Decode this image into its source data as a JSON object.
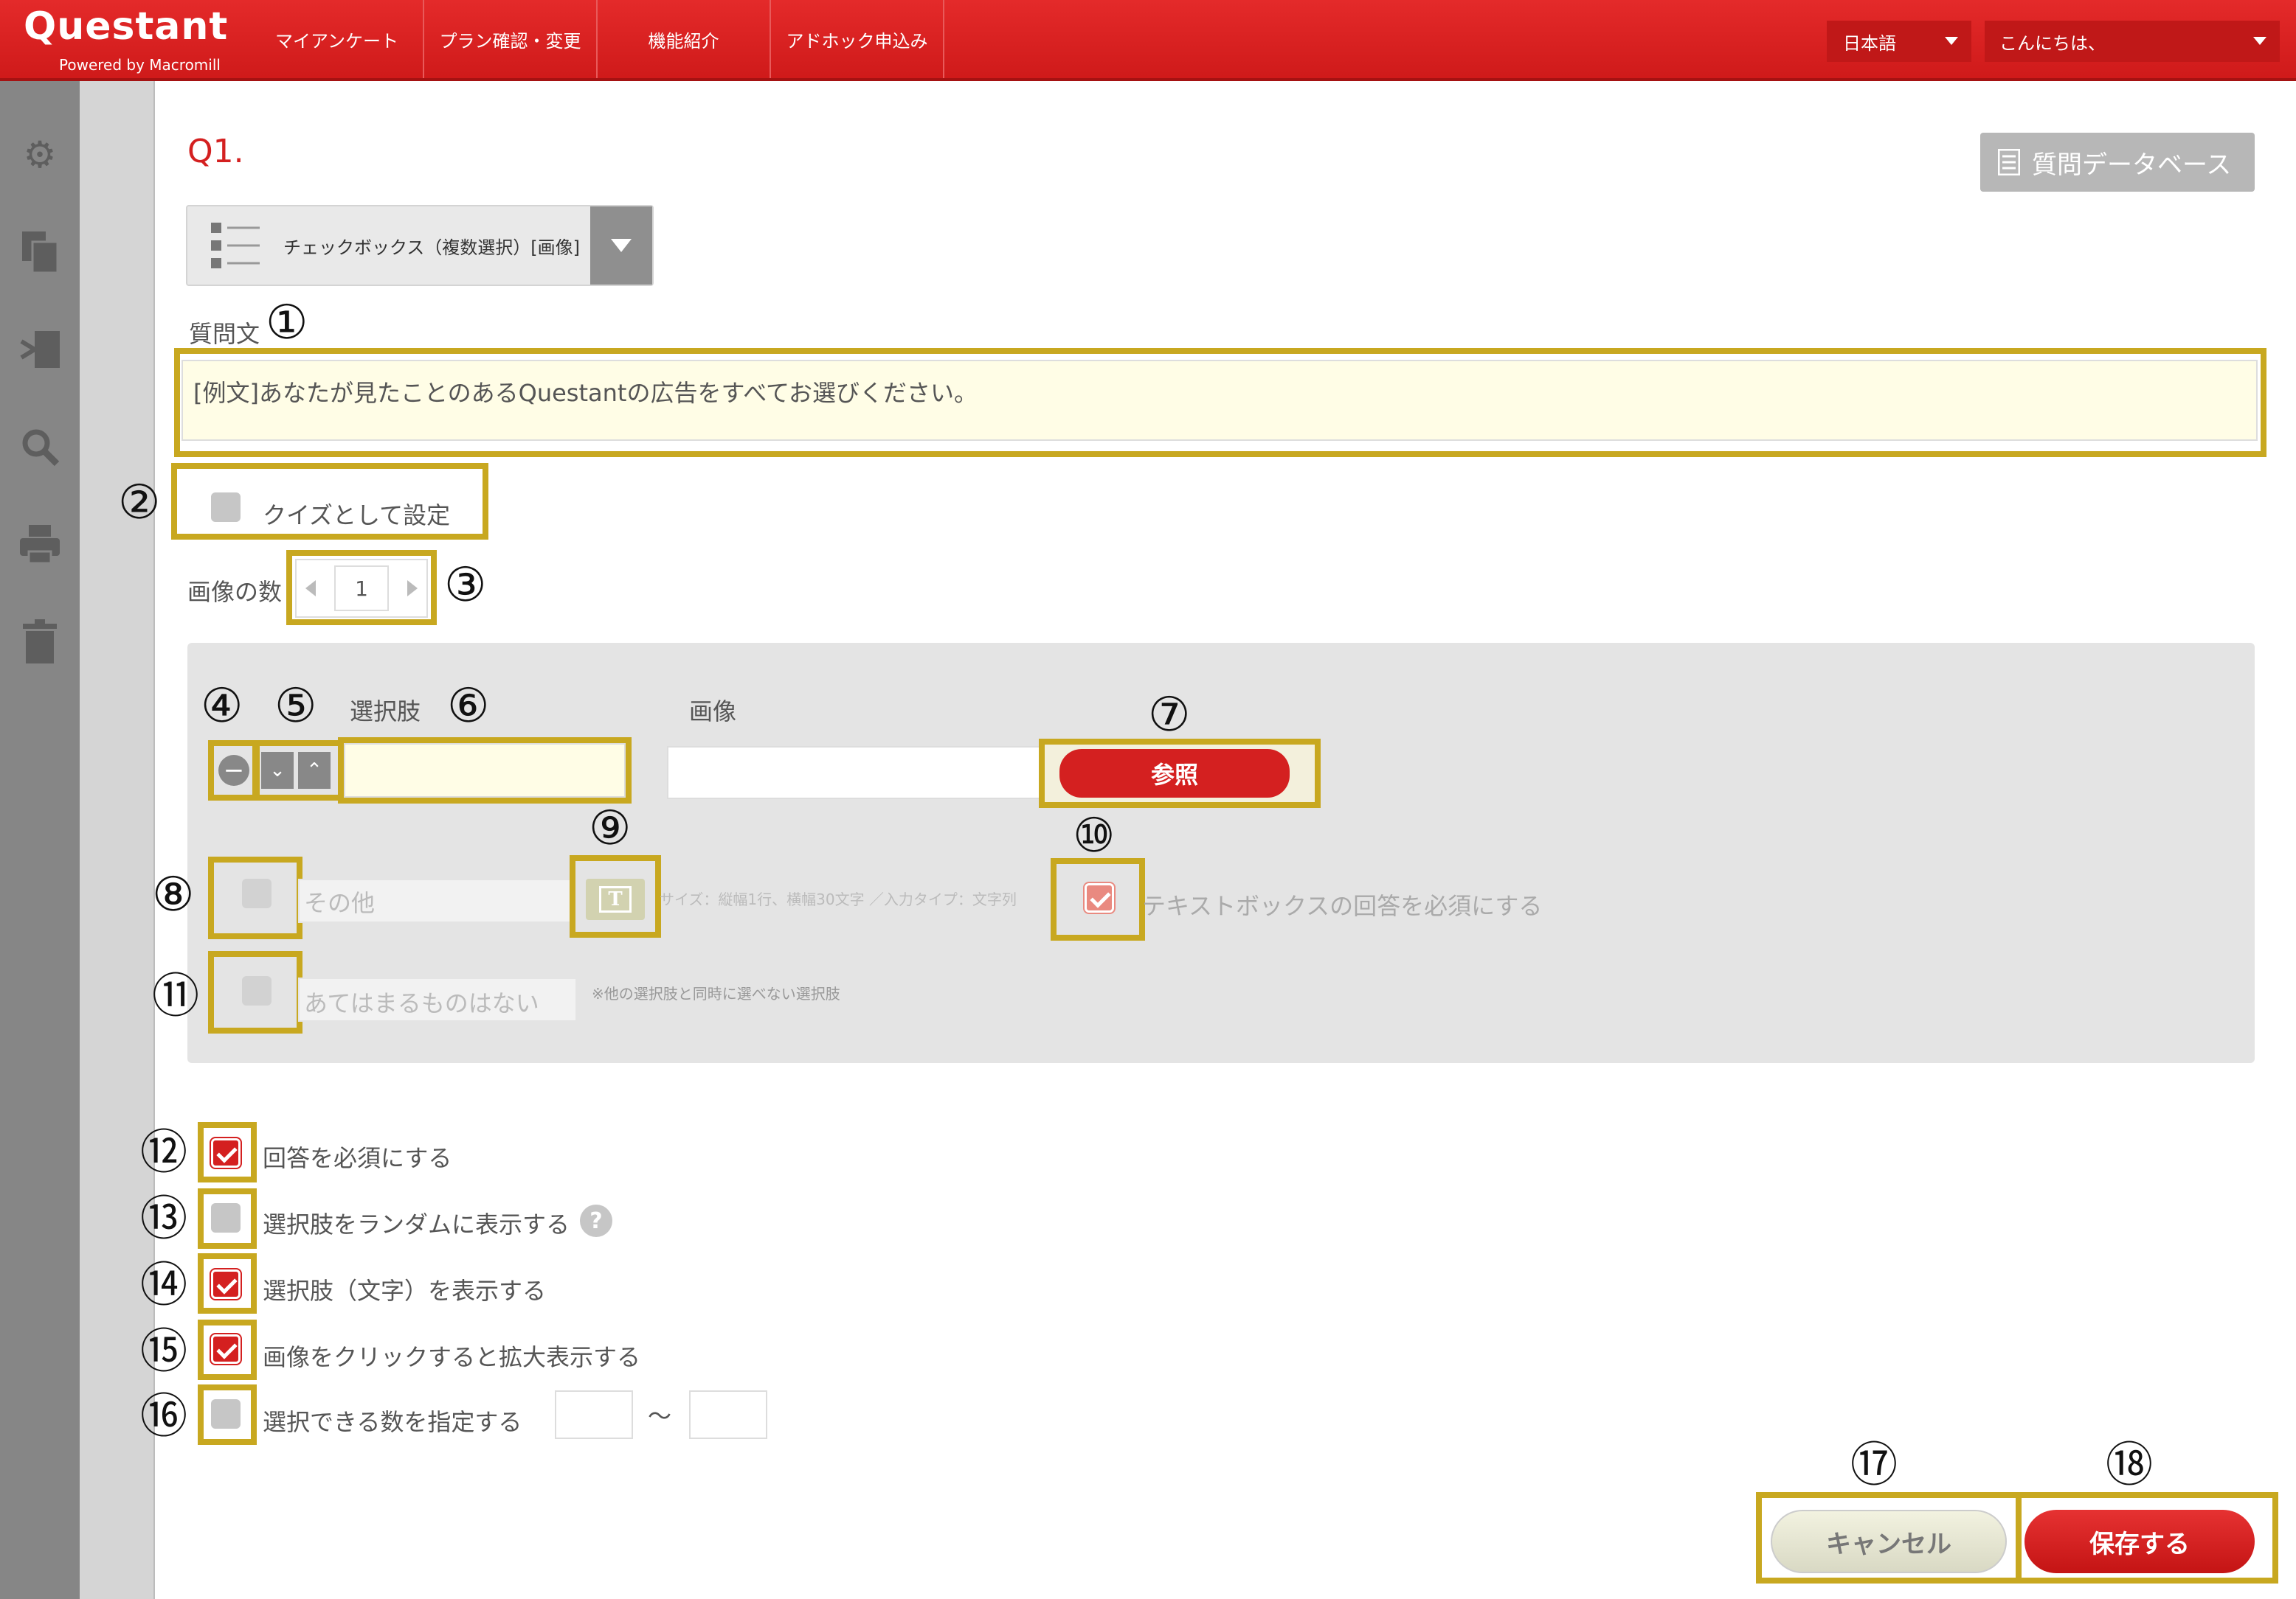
{
  "header": {
    "logo": "Questant",
    "logo_sub": "Powered by Macromill",
    "nav": [
      "マイアンケート",
      "プラン確認・変更",
      "機能紹介",
      "アドホック申込み"
    ],
    "language": "日本語",
    "greeting": "こんにちは、"
  },
  "sidebar_icons": [
    "gear-icon",
    "copy-icon",
    "branch-icon",
    "search-icon",
    "print-icon",
    "trash-icon"
  ],
  "question": {
    "number": "Q1.",
    "db_button": "質問データベース",
    "type_label": "チェックボックス（複数選択）[画像]",
    "text_label": "質問文",
    "text_value": "[例文]あなたが見たことのあるQuestantの広告をすべてお選びください。",
    "quiz_label": "クイズとして設定",
    "image_count_label": "画像の数",
    "image_count": "1"
  },
  "panel": {
    "choice_header": "選択肢",
    "image_header": "画像",
    "browse_button": "参照",
    "other_label": "その他",
    "other_note": "サイズ：縦幅1行、横幅30文字 ／入力タイプ：文字列",
    "textbox_required": "テキストボックスの回答を必須にする",
    "none_label": "あてはまるものはない",
    "none_note": "※他の選択肢と同時に選べない選択肢"
  },
  "options": [
    {
      "label": "回答を必須にする",
      "checked": true
    },
    {
      "label": "選択肢をランダムに表示する",
      "checked": false
    },
    {
      "label": "選択肢（文字）を表示する",
      "checked": true
    },
    {
      "label": "画像をクリックすると拡大表示する",
      "checked": true
    },
    {
      "label": "選択できる数を指定する",
      "checked": false
    }
  ],
  "range_separator": "〜",
  "buttons": {
    "cancel": "キャンセル",
    "save": "保存する"
  },
  "annotations": [
    "①",
    "②",
    "③",
    "④",
    "⑤",
    "⑥",
    "⑦",
    "⑧",
    "⑨",
    "⑩",
    "⑪",
    "⑫",
    "⑬",
    "⑭",
    "⑮",
    "⑯",
    "⑰",
    "⑱"
  ],
  "colors": {
    "brand": "#d42020",
    "highlight": "#c8a820",
    "sidebar": "#868686"
  }
}
